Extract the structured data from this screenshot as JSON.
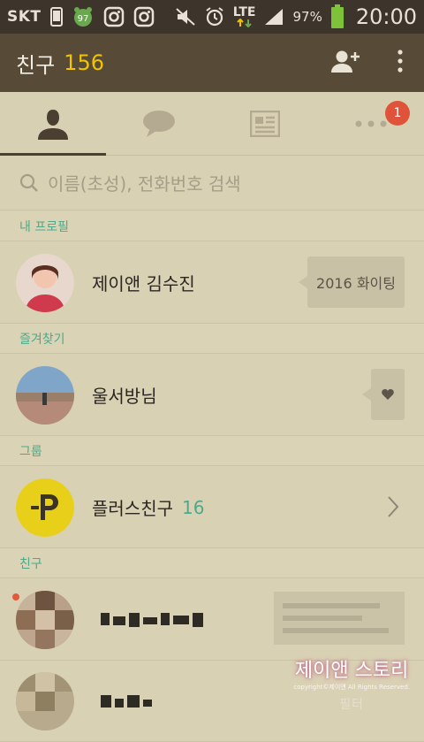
{
  "statusbar": {
    "carrier": "SKT",
    "network": "LTE",
    "battery_pct": "97%",
    "time": "20:00",
    "notif_badge": "97"
  },
  "appbar": {
    "title": "친구",
    "count": "156",
    "add_friend_icon": "add-friend-icon",
    "more_icon": "more-vert-icon"
  },
  "tabs": [
    {
      "name": "friends",
      "icon": "person-icon",
      "active": true
    },
    {
      "name": "chats",
      "icon": "chat-bubble-icon",
      "active": false
    },
    {
      "name": "channel",
      "icon": "news-icon",
      "active": false
    },
    {
      "name": "more",
      "icon": "more-horiz-icon",
      "active": false,
      "badge": "1"
    }
  ],
  "search": {
    "placeholder": "이름(초성), 전화번호 검색"
  },
  "sections": {
    "my_profile": "내 프로필",
    "favorites": "즐겨찾기",
    "groups": "그룹",
    "friends": "친구"
  },
  "my_profile": {
    "name": "제이앤 김수진",
    "status": "2016 화이팅"
  },
  "favorite": {
    "name": "울서방님"
  },
  "group": {
    "name": "플러스친구",
    "count": "16"
  },
  "watermark": {
    "title": "제이앤 스토리",
    "copyright": "copyright©제이앤 All Rights Reserved.",
    "tail": "필터"
  },
  "colors": {
    "statusbar": "#3d352b",
    "appbar": "#574a36",
    "accent_count": "#f2c300",
    "section_green": "#4ea98a",
    "badge_red": "#e0533b",
    "plus_yellow": "#e8cf1a"
  }
}
